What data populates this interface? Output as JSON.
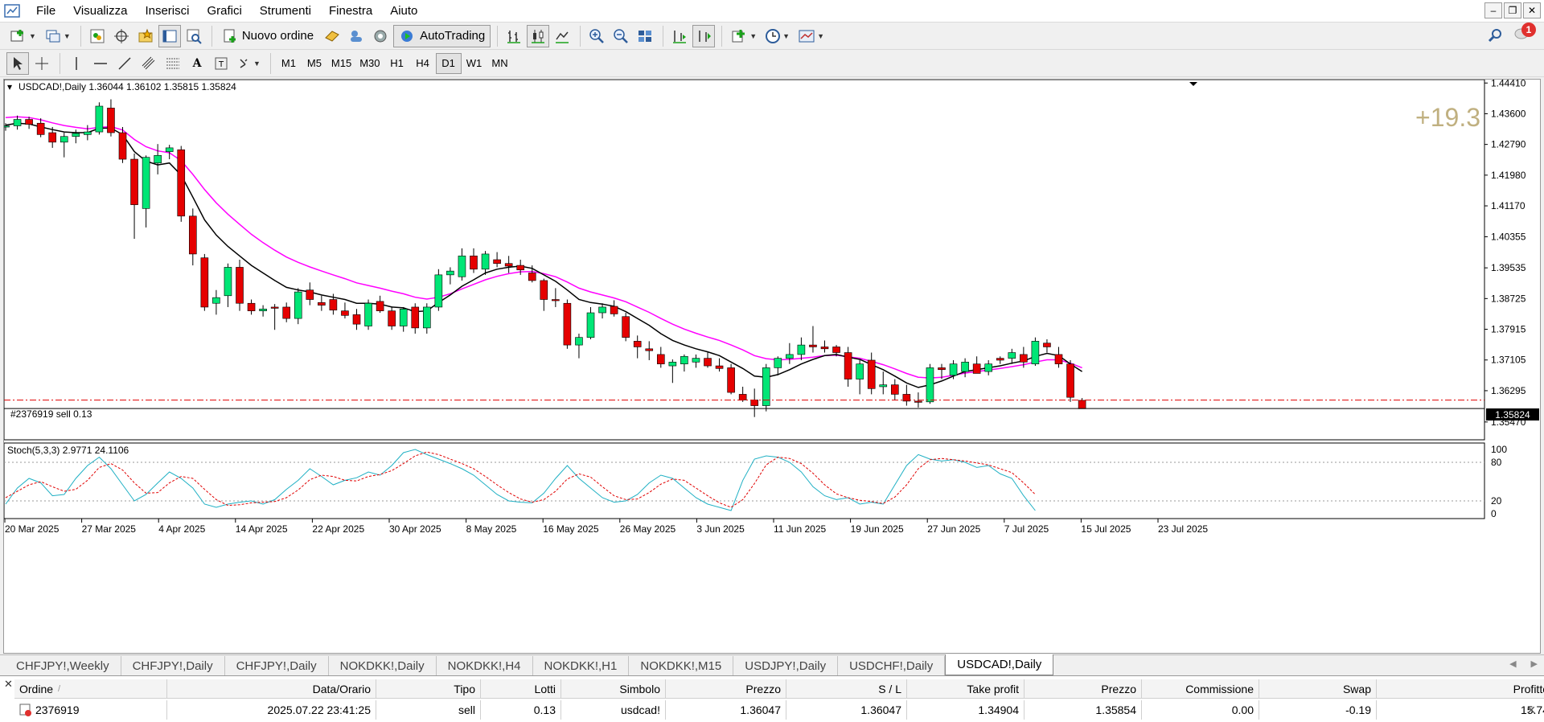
{
  "menu": [
    "File",
    "Visualizza",
    "Inserisci",
    "Grafici",
    "Strumenti",
    "Finestra",
    "Aiuto"
  ],
  "toolbar": {
    "new_order_label": "Nuovo ordine",
    "autotrading_label": "AutoTrading",
    "notification_count": "1"
  },
  "timeframes": [
    "M1",
    "M5",
    "M15",
    "M30",
    "H1",
    "H4",
    "D1",
    "W1",
    "MN"
  ],
  "active_timeframe": "D1",
  "chart": {
    "header": "USDCAD!,Daily  1.36044 1.36102 1.35815 1.35824",
    "profit_overlay": "+19.3",
    "order_line_label": "#2376919 sell 0.13",
    "current_price_label": "1.35824",
    "indicator_label": "Stoch(5,3,3) 2.9771 24.1106"
  },
  "chart_data": {
    "type": "candlestick",
    "symbol": "USDCAD!",
    "timeframe": "Daily",
    "y_ticks": [
      "1.44410",
      "1.43600",
      "1.42790",
      "1.41980",
      "1.41170",
      "1.40355",
      "1.39535",
      "1.38725",
      "1.37915",
      "1.37105",
      "1.36295",
      "1.35470"
    ],
    "ylim": [
      1.35,
      1.445
    ],
    "x_ticks": [
      "20 Mar 2025",
      "27 Mar 2025",
      "4 Apr 2025",
      "14 Apr 2025",
      "22 Apr 2025",
      "30 Apr 2025",
      "8 May 2025",
      "16 May 2025",
      "26 May 2025",
      "3 Jun 2025",
      "11 Jun 2025",
      "19 Jun 2025",
      "27 Jun 2025",
      "7 Jul 2025",
      "15 Jul 2025",
      "23 Jul 2025"
    ],
    "order_price": 1.36047,
    "current_price": 1.35824,
    "candles": [
      [
        1.4325,
        1.4335,
        1.4315,
        1.4328
      ],
      [
        1.4328,
        1.4355,
        1.4318,
        1.4345
      ],
      [
        1.4345,
        1.4352,
        1.432,
        1.4332
      ],
      [
        1.4335,
        1.4348,
        1.4298,
        1.4305
      ],
      [
        1.431,
        1.4325,
        1.427,
        1.4285
      ],
      [
        1.4285,
        1.431,
        1.4245,
        1.43
      ],
      [
        1.43,
        1.4318,
        1.4282,
        1.4308
      ],
      [
        1.4305,
        1.433,
        1.429,
        1.4312
      ],
      [
        1.4312,
        1.439,
        1.4305,
        1.438
      ],
      [
        1.4375,
        1.4398,
        1.43,
        1.431
      ],
      [
        1.431,
        1.4325,
        1.423,
        1.424
      ],
      [
        1.424,
        1.4255,
        1.403,
        1.412
      ],
      [
        1.411,
        1.425,
        1.406,
        1.4245
      ],
      [
        1.423,
        1.428,
        1.42,
        1.425
      ],
      [
        1.426,
        1.4278,
        1.424,
        1.427
      ],
      [
        1.4265,
        1.4275,
        1.4075,
        1.409
      ],
      [
        1.409,
        1.411,
        1.396,
        1.399
      ],
      [
        1.398,
        1.399,
        1.384,
        1.385
      ],
      [
        1.386,
        1.3895,
        1.383,
        1.3875
      ],
      [
        1.388,
        1.3965,
        1.385,
        1.3955
      ],
      [
        1.3955,
        1.3975,
        1.384,
        1.386
      ],
      [
        1.386,
        1.387,
        1.383,
        1.384
      ],
      [
        1.384,
        1.3855,
        1.3825,
        1.3845
      ],
      [
        1.385,
        1.3858,
        1.379,
        1.3848
      ],
      [
        1.385,
        1.3862,
        1.381,
        1.382
      ],
      [
        1.382,
        1.39,
        1.3805,
        1.389
      ],
      [
        1.3895,
        1.3915,
        1.3855,
        1.387
      ],
      [
        1.3862,
        1.388,
        1.384,
        1.3855
      ],
      [
        1.387,
        1.3885,
        1.383,
        1.3842
      ],
      [
        1.384,
        1.3862,
        1.382,
        1.3828
      ],
      [
        1.383,
        1.3845,
        1.379,
        1.3805
      ],
      [
        1.38,
        1.387,
        1.379,
        1.386
      ],
      [
        1.3865,
        1.388,
        1.3835,
        1.384
      ],
      [
        1.384,
        1.3852,
        1.379,
        1.38
      ],
      [
        1.38,
        1.385,
        1.3785,
        1.3845
      ],
      [
        1.385,
        1.386,
        1.378,
        1.3795
      ],
      [
        1.3795,
        1.386,
        1.378,
        1.385
      ],
      [
        1.385,
        1.395,
        1.384,
        1.3935
      ],
      [
        1.3935,
        1.3955,
        1.391,
        1.3945
      ],
      [
        1.393,
        1.4005,
        1.392,
        1.3985
      ],
      [
        1.3985,
        1.4005,
        1.394,
        1.395
      ],
      [
        1.395,
        1.3998,
        1.3935,
        1.399
      ],
      [
        1.3975,
        1.3995,
        1.3955,
        1.3965
      ],
      [
        1.3965,
        1.3985,
        1.394,
        1.3958
      ],
      [
        1.396,
        1.3975,
        1.3935,
        1.3948
      ],
      [
        1.394,
        1.396,
        1.3915,
        1.392
      ],
      [
        1.392,
        1.3925,
        1.384,
        1.387
      ],
      [
        1.387,
        1.39,
        1.385,
        1.3868
      ],
      [
        1.386,
        1.387,
        1.374,
        1.375
      ],
      [
        1.375,
        1.378,
        1.3715,
        1.377
      ],
      [
        1.377,
        1.385,
        1.3765,
        1.3835
      ],
      [
        1.3835,
        1.386,
        1.382,
        1.385
      ],
      [
        1.3852,
        1.3868,
        1.3825,
        1.3832
      ],
      [
        1.3825,
        1.3835,
        1.376,
        1.377
      ],
      [
        1.376,
        1.3775,
        1.3715,
        1.3745
      ],
      [
        1.374,
        1.376,
        1.371,
        1.3735
      ],
      [
        1.3725,
        1.3745,
        1.369,
        1.37
      ],
      [
        1.3695,
        1.3712,
        1.365,
        1.3705
      ],
      [
        1.37,
        1.3725,
        1.368,
        1.372
      ],
      [
        1.3705,
        1.3725,
        1.369,
        1.3715
      ],
      [
        1.3715,
        1.373,
        1.369,
        1.3695
      ],
      [
        1.3695,
        1.3715,
        1.368,
        1.3688
      ],
      [
        1.369,
        1.37,
        1.362,
        1.3625
      ],
      [
        1.362,
        1.364,
        1.36,
        1.3605
      ],
      [
        1.3605,
        1.3635,
        1.356,
        1.359
      ],
      [
        1.359,
        1.37,
        1.3575,
        1.369
      ],
      [
        1.369,
        1.372,
        1.367,
        1.3715
      ],
      [
        1.3715,
        1.3755,
        1.37,
        1.3725
      ],
      [
        1.3725,
        1.377,
        1.371,
        1.375
      ],
      [
        1.375,
        1.38,
        1.373,
        1.3745
      ],
      [
        1.3745,
        1.3762,
        1.373,
        1.374
      ],
      [
        1.3745,
        1.375,
        1.372,
        1.373
      ],
      [
        1.373,
        1.3745,
        1.364,
        1.366
      ],
      [
        1.366,
        1.371,
        1.362,
        1.37
      ],
      [
        1.371,
        1.373,
        1.362,
        1.3635
      ],
      [
        1.364,
        1.368,
        1.362,
        1.3645
      ],
      [
        1.3645,
        1.366,
        1.3605,
        1.362
      ],
      [
        1.362,
        1.3645,
        1.359,
        1.3602
      ],
      [
        1.3602,
        1.3625,
        1.3585,
        1.36
      ],
      [
        1.36,
        1.37,
        1.3595,
        1.369
      ],
      [
        1.369,
        1.37,
        1.366,
        1.3685
      ],
      [
        1.367,
        1.371,
        1.366,
        1.37
      ],
      [
        1.368,
        1.3715,
        1.3665,
        1.3705
      ],
      [
        1.37,
        1.372,
        1.368,
        1.3675
      ],
      [
        1.368,
        1.371,
        1.367,
        1.37
      ],
      [
        1.3715,
        1.372,
        1.37,
        1.371
      ],
      [
        1.3715,
        1.374,
        1.37,
        1.373
      ],
      [
        1.3725,
        1.3745,
        1.369,
        1.3705
      ],
      [
        1.37,
        1.377,
        1.3695,
        1.376
      ],
      [
        1.3755,
        1.3765,
        1.373,
        1.3745
      ],
      [
        1.3725,
        1.3745,
        1.369,
        1.37
      ],
      [
        1.37,
        1.371,
        1.36,
        1.3612
      ],
      [
        1.3604,
        1.361,
        1.3582,
        1.3582
      ]
    ],
    "ma_fast": [
      1.433,
      1.4335,
      1.4333,
      1.4325,
      1.4318,
      1.4312,
      1.431,
      1.431,
      1.4322,
      1.4322,
      1.4305,
      1.426,
      1.4235,
      1.4225,
      1.423,
      1.4198,
      1.414,
      1.408,
      1.404,
      1.401,
      1.3985,
      1.396,
      1.394,
      1.392,
      1.3902,
      1.3895,
      1.389,
      1.3882,
      1.3876,
      1.387,
      1.386,
      1.386,
      1.3858,
      1.385,
      1.3848,
      1.3838,
      1.384,
      1.3862,
      1.3882,
      1.3905,
      1.3922,
      1.394,
      1.395,
      1.3955,
      1.3958,
      1.3952,
      1.3935,
      1.3918,
      1.3895,
      1.387,
      1.3862,
      1.3858,
      1.3852,
      1.3838,
      1.382,
      1.3802,
      1.378,
      1.3762,
      1.375,
      1.374,
      1.3732,
      1.3722,
      1.3705,
      1.3688,
      1.3668,
      1.3665,
      1.3672,
      1.3685,
      1.37,
      1.3712,
      1.3722,
      1.3725,
      1.3718,
      1.3712,
      1.3698,
      1.3685,
      1.3668,
      1.365,
      1.3638,
      1.3645,
      1.3655,
      1.3668,
      1.368,
      1.3685,
      1.369,
      1.3695,
      1.3702,
      1.3708,
      1.372,
      1.3728,
      1.3722,
      1.37,
      1.368
    ],
    "ma_slow": [
      1.435,
      1.4352,
      1.435,
      1.4344,
      1.4336,
      1.4329,
      1.4324,
      1.432,
      1.4324,
      1.4326,
      1.4317,
      1.4292,
      1.4273,
      1.4262,
      1.4257,
      1.4236,
      1.42,
      1.416,
      1.4125,
      1.4095,
      1.4068,
      1.4042,
      1.402,
      1.4,
      1.3982,
      1.3968,
      1.3956,
      1.3945,
      1.3935,
      1.3925,
      1.3914,
      1.3907,
      1.39,
      1.3892,
      1.3885,
      1.3876,
      1.3871,
      1.3876,
      1.3885,
      1.3898,
      1.391,
      1.3922,
      1.3931,
      1.3938,
      1.3943,
      1.3944,
      1.3938,
      1.393,
      1.3916,
      1.39,
      1.389,
      1.3882,
      1.3874,
      1.3864,
      1.385,
      1.3836,
      1.382,
      1.3805,
      1.3792,
      1.3781,
      1.3771,
      1.3762,
      1.375,
      1.3737,
      1.3722,
      1.3714,
      1.3711,
      1.3712,
      1.3715,
      1.3718,
      1.3722,
      1.3723,
      1.3719,
      1.3715,
      1.3707,
      1.3698,
      1.3687,
      1.3675,
      1.3665,
      1.3663,
      1.3665,
      1.367,
      1.3676,
      1.368,
      1.3684,
      1.3688,
      1.3693,
      1.3698,
      1.3705,
      1.3711,
      1.3711,
      1.3702,
      1.369
    ],
    "stoch_k": [
      15,
      40,
      55,
      48,
      28,
      30,
      55,
      75,
      88,
      70,
      45,
      20,
      30,
      48,
      65,
      55,
      40,
      15,
      10,
      15,
      18,
      20,
      15,
      22,
      38,
      52,
      70,
      58,
      45,
      52,
      56,
      65,
      60,
      75,
      95,
      100,
      92,
      85,
      78,
      70,
      60,
      45,
      30,
      20,
      18,
      17,
      32,
      55,
      75,
      55,
      40,
      25,
      18,
      20,
      30,
      48,
      60,
      55,
      40,
      25,
      15,
      10,
      5,
      52,
      85,
      90,
      88,
      80,
      65,
      42,
      28,
      22,
      25,
      15,
      18,
      15,
      45,
      75,
      92,
      85,
      82,
      84,
      80,
      72,
      75,
      62,
      55,
      28,
      5
    ],
    "stoch_d": [
      25,
      35,
      45,
      50,
      42,
      35,
      38,
      52,
      72,
      78,
      68,
      48,
      32,
      33,
      48,
      58,
      55,
      38,
      22,
      13,
      14,
      17,
      18,
      19,
      25,
      37,
      53,
      60,
      58,
      52,
      51,
      58,
      61,
      67,
      78,
      90,
      96,
      92,
      85,
      78,
      70,
      58,
      45,
      33,
      23,
      18,
      22,
      35,
      54,
      62,
      57,
      42,
      28,
      22,
      23,
      33,
      46,
      54,
      52,
      40,
      28,
      17,
      10,
      22,
      47,
      76,
      88,
      86,
      78,
      63,
      45,
      31,
      25,
      21,
      19,
      16,
      26,
      45,
      70,
      84,
      86,
      84,
      82,
      79,
      76,
      70,
      64,
      48,
      30
    ]
  },
  "tabs": [
    "CHFJPY!,Weekly",
    "CHFJPY!,Daily",
    "CHFJPY!,Daily",
    "NOKDKK!,Daily",
    "NOKDKK!,H4",
    "NOKDKK!,H1",
    "NOKDKK!,M15",
    "USDJPY!,Daily",
    "USDCHF!,Daily",
    "USDCAD!,Daily"
  ],
  "active_tab": 9,
  "terminal": {
    "headers": [
      "Ordine",
      "Data/Orario",
      "Tipo",
      "Lotti",
      "Simbolo",
      "Prezzo",
      "S / L",
      "Take profit",
      "Prezzo",
      "Commissione",
      "Swap",
      "Profitto"
    ],
    "sort_indicator": "/",
    "row": [
      "2376919",
      "2025.07.22 23:41:25",
      "sell",
      "0.13",
      "usdcad!",
      "1.36047",
      "1.36047",
      "1.34904",
      "1.35854",
      "0.00",
      "-0.19",
      "15.74"
    ]
  },
  "colors": {
    "bull": "#00e676",
    "bear": "#e50000",
    "ma_fast": "#000000",
    "ma_slow": "#ff00ff",
    "stoch_k": "#1fb0c4",
    "stoch_d": "#e00000",
    "profit_overlay": "#c0b080"
  }
}
